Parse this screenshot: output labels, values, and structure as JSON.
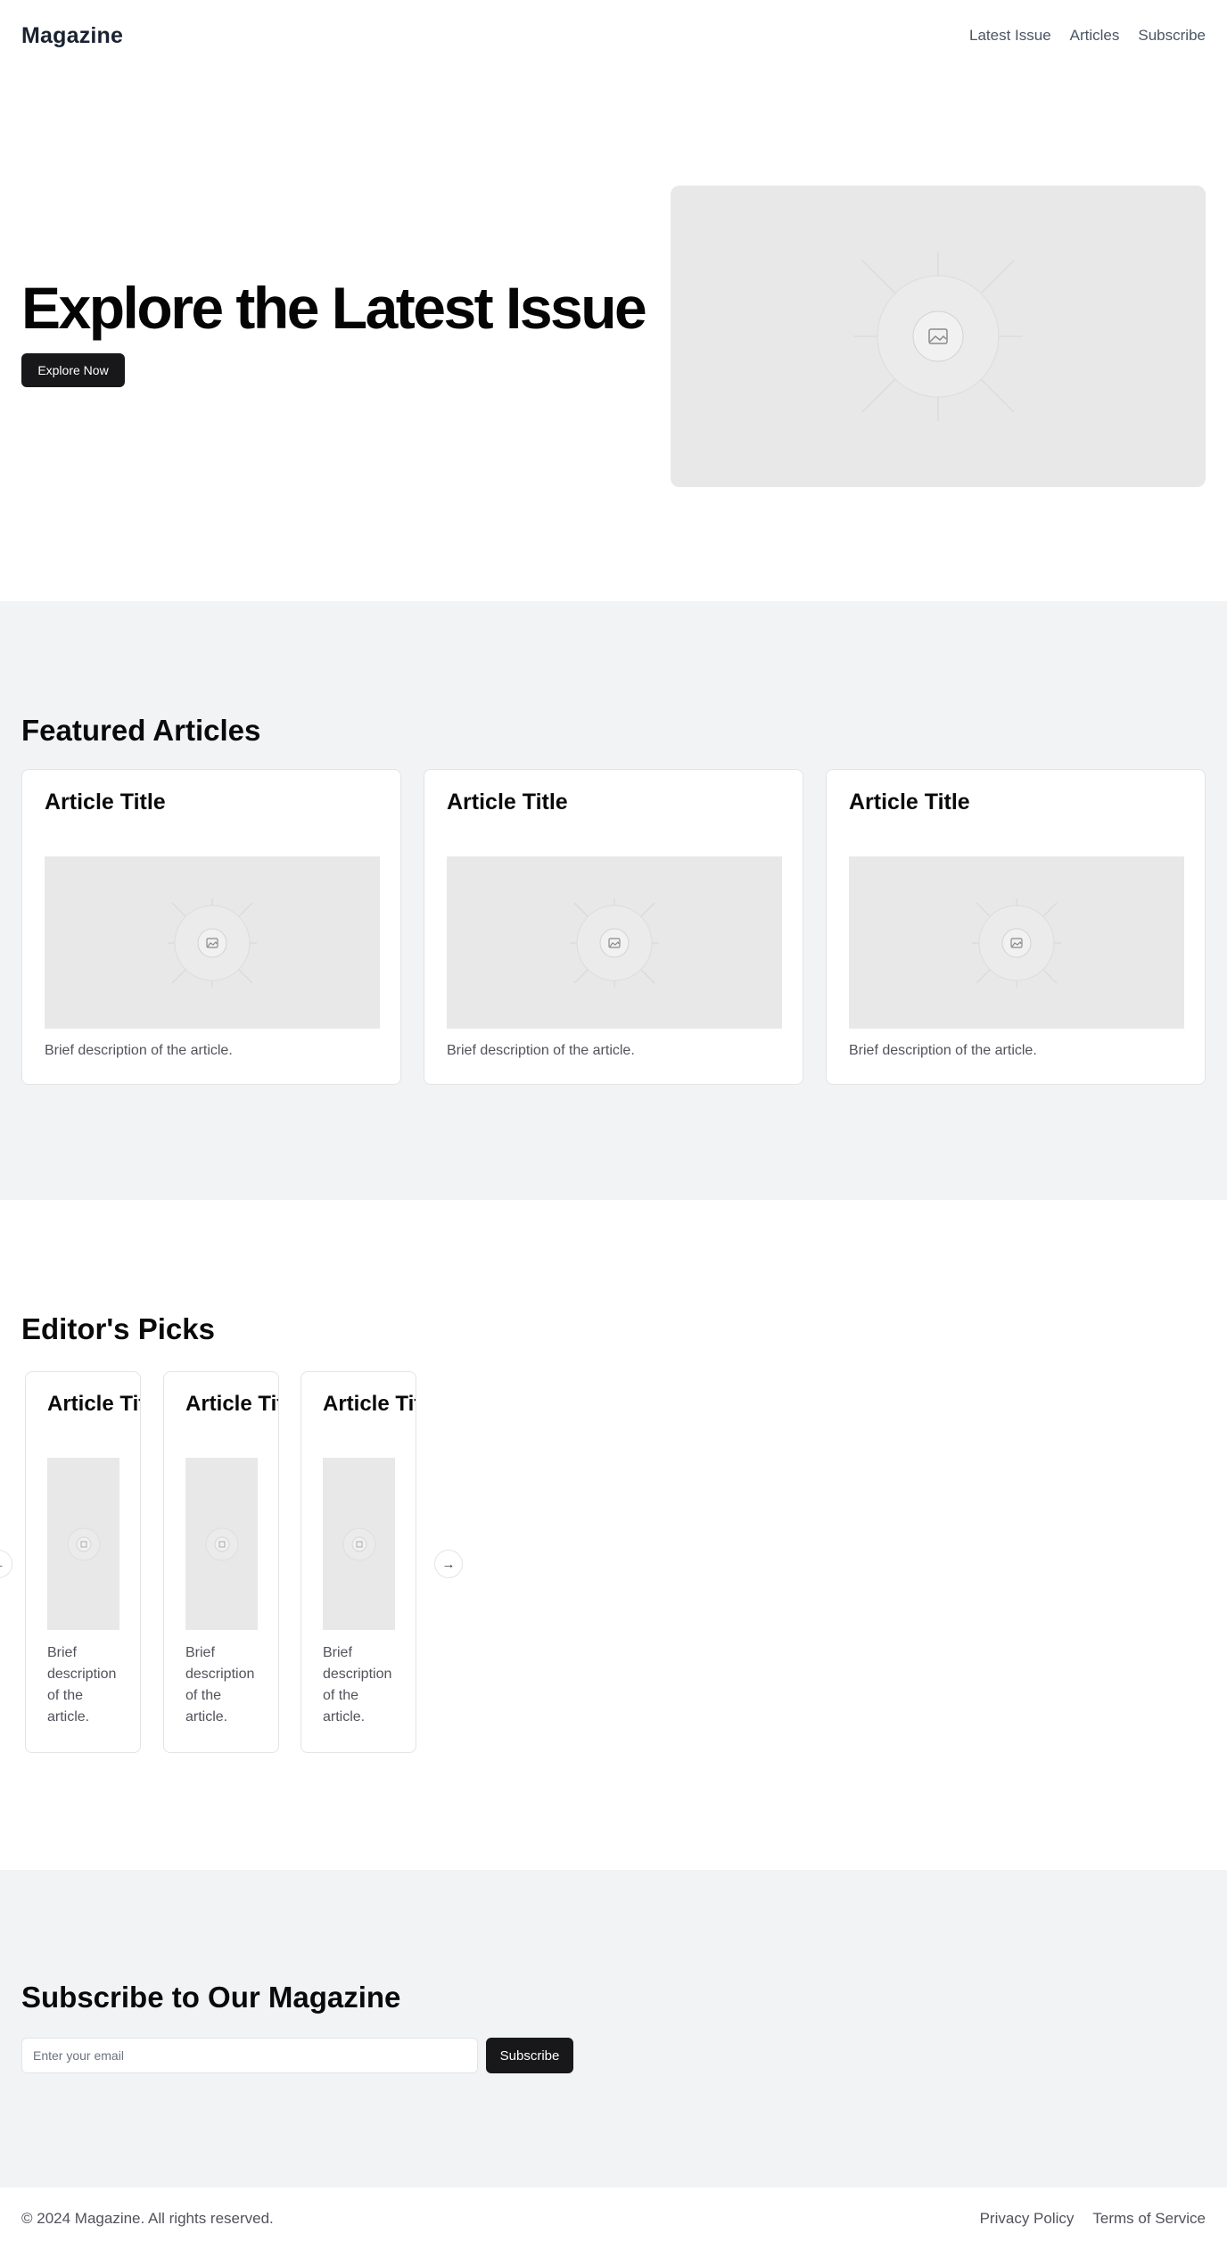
{
  "header": {
    "logo": "Magazine",
    "nav": [
      "Latest Issue",
      "Articles",
      "Subscribe"
    ]
  },
  "hero": {
    "title": "Explore the Latest Issue",
    "button": "Explore Now",
    "image_icon": "image-icon"
  },
  "featured": {
    "title": "Featured Articles",
    "cards": [
      {
        "title": "Article Title",
        "description": "Brief description of the article."
      },
      {
        "title": "Article Title",
        "description": "Brief description of the article."
      },
      {
        "title": "Article Title",
        "description": "Brief description of the article."
      }
    ]
  },
  "picks": {
    "title": "Editor's Picks",
    "cards": [
      {
        "title": "Article Title",
        "description": "Brief description of the article."
      },
      {
        "title": "Article Title",
        "description": "Brief description of the article."
      },
      {
        "title": "Article Title",
        "description": "Brief description of the article."
      }
    ],
    "prev_icon": "arrow-left-icon",
    "next_icon": "arrow-right-icon"
  },
  "subscribe": {
    "title": "Subscribe to Our Magazine",
    "email_placeholder": "Enter your email",
    "email_value": "",
    "button": "Subscribe"
  },
  "footer": {
    "copyright": "© 2024 Magazine. All rights reserved.",
    "links": [
      "Privacy Policy",
      "Terms of Service"
    ]
  },
  "colors": {
    "primary_button": "#18181b",
    "section_background": "#f2f3f5",
    "placeholder_image": "#e8e8e8",
    "muted_text": "#52525b"
  }
}
